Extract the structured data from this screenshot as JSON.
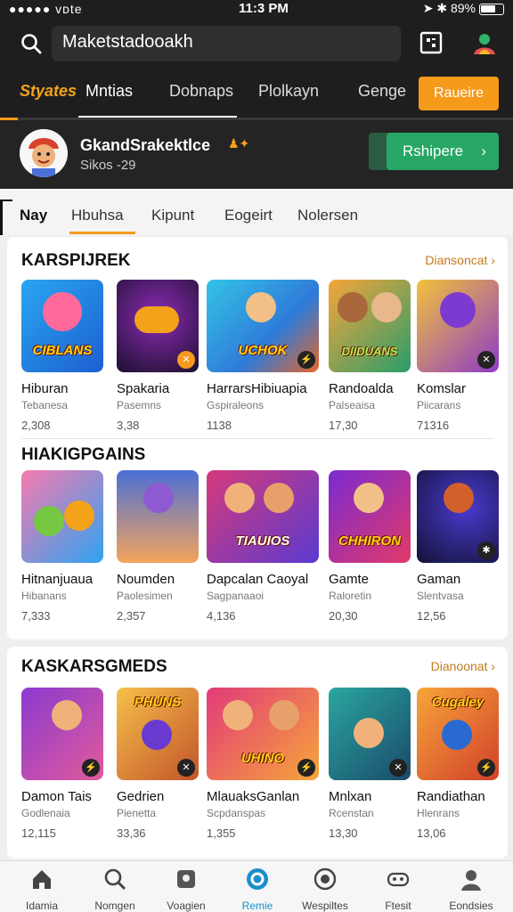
{
  "status_bar": {
    "left": "●●●●● ᴠᴅte",
    "time": "11:3 PM",
    "battery": "89%"
  },
  "search": {
    "value": "Maketstadooakh"
  },
  "tabs": [
    {
      "label": "Styates"
    },
    {
      "label": "Mntias"
    },
    {
      "label": "Dobnaps"
    },
    {
      "label": "Plolkayn"
    },
    {
      "label": "Genge"
    }
  ],
  "tab_button": "Raueire",
  "user": {
    "name": "GkandSrakektlce",
    "sub": "Sikos -29",
    "action": "Rshipere"
  },
  "subtabs": [
    "Nay",
    "Hbuhsa",
    "Kipunt",
    "Eogeirt",
    "Nolersen"
  ],
  "sections": [
    {
      "title": "KARSPIJREK",
      "link": "Diansoncat",
      "games": [
        {
          "name": "Hiburan",
          "cat": "Tebanesa",
          "num": "2,308",
          "thumb_text": "CIBLANS"
        },
        {
          "name": "Spakaria",
          "cat": "Pasemns",
          "num": "3,38",
          "thumb_text": ""
        },
        {
          "name": "HarrarsHibiuapia",
          "cat": "Gspiraleons",
          "num": "1138",
          "thumb_text": "UCHOK"
        },
        {
          "name": "Randoalda",
          "cat": "Palseaisa",
          "num": "17,30",
          "thumb_text": "DIIDUANS"
        },
        {
          "name": "Komslar",
          "cat": "Piicarans",
          "num": "71316",
          "thumb_text": ""
        }
      ]
    },
    {
      "title": "HIAKIGPGAINS",
      "link": "",
      "games": [
        {
          "name": "Hitnanjuaua",
          "cat": "Hibanans",
          "num": "7,333",
          "thumb_text": ""
        },
        {
          "name": "Noumden",
          "cat": "Paolesimen",
          "num": "2,357",
          "thumb_text": ""
        },
        {
          "name": "Dapcalan Caoyal",
          "cat": "Sagpanaaoi",
          "num": "4,136",
          "thumb_text": "TIAUIOS"
        },
        {
          "name": "Gamte",
          "cat": "Raloretin",
          "num": "20,30",
          "thumb_text": "CHHIRON"
        },
        {
          "name": "Gaman",
          "cat": "Slentvasa",
          "num": "12,56",
          "thumb_text": ""
        }
      ]
    },
    {
      "title": "KASKARSGMEDS",
      "link": "Dianoonat",
      "games": [
        {
          "name": "Damon Tais",
          "cat": "Godlenaia",
          "num": "12,115",
          "thumb_text": ""
        },
        {
          "name": "Gedrien",
          "cat": "Pienetta",
          "num": "33,36",
          "thumb_text": "PHUNS"
        },
        {
          "name": "MlauaksGanlan",
          "cat": "Scpdanspas",
          "num": "1,355",
          "thumb_text": "UHINO"
        },
        {
          "name": "Mnlxan",
          "cat": "Rcenstan",
          "num": "13,30",
          "thumb_text": ""
        },
        {
          "name": "Randiathan",
          "cat": "Hlenrans",
          "num": "13,06",
          "thumb_text": "Cugaley"
        }
      ]
    }
  ],
  "bottom_nav": [
    {
      "label": "Idamia",
      "icon": "home-icon"
    },
    {
      "label": "Nomgen",
      "icon": "search-icon"
    },
    {
      "label": "Voagien",
      "icon": "gamepad-icon"
    },
    {
      "label": "Remie",
      "icon": "game-center-icon"
    },
    {
      "label": "Wespiltes",
      "icon": "target-icon"
    },
    {
      "label": "Ftesit",
      "icon": "controller-icon"
    },
    {
      "label": "Eondsies",
      "icon": "profile-icon"
    }
  ],
  "colors": {
    "accent": "#f59a1b",
    "green": "#26a765",
    "active_nav": "#1a8fc9"
  }
}
